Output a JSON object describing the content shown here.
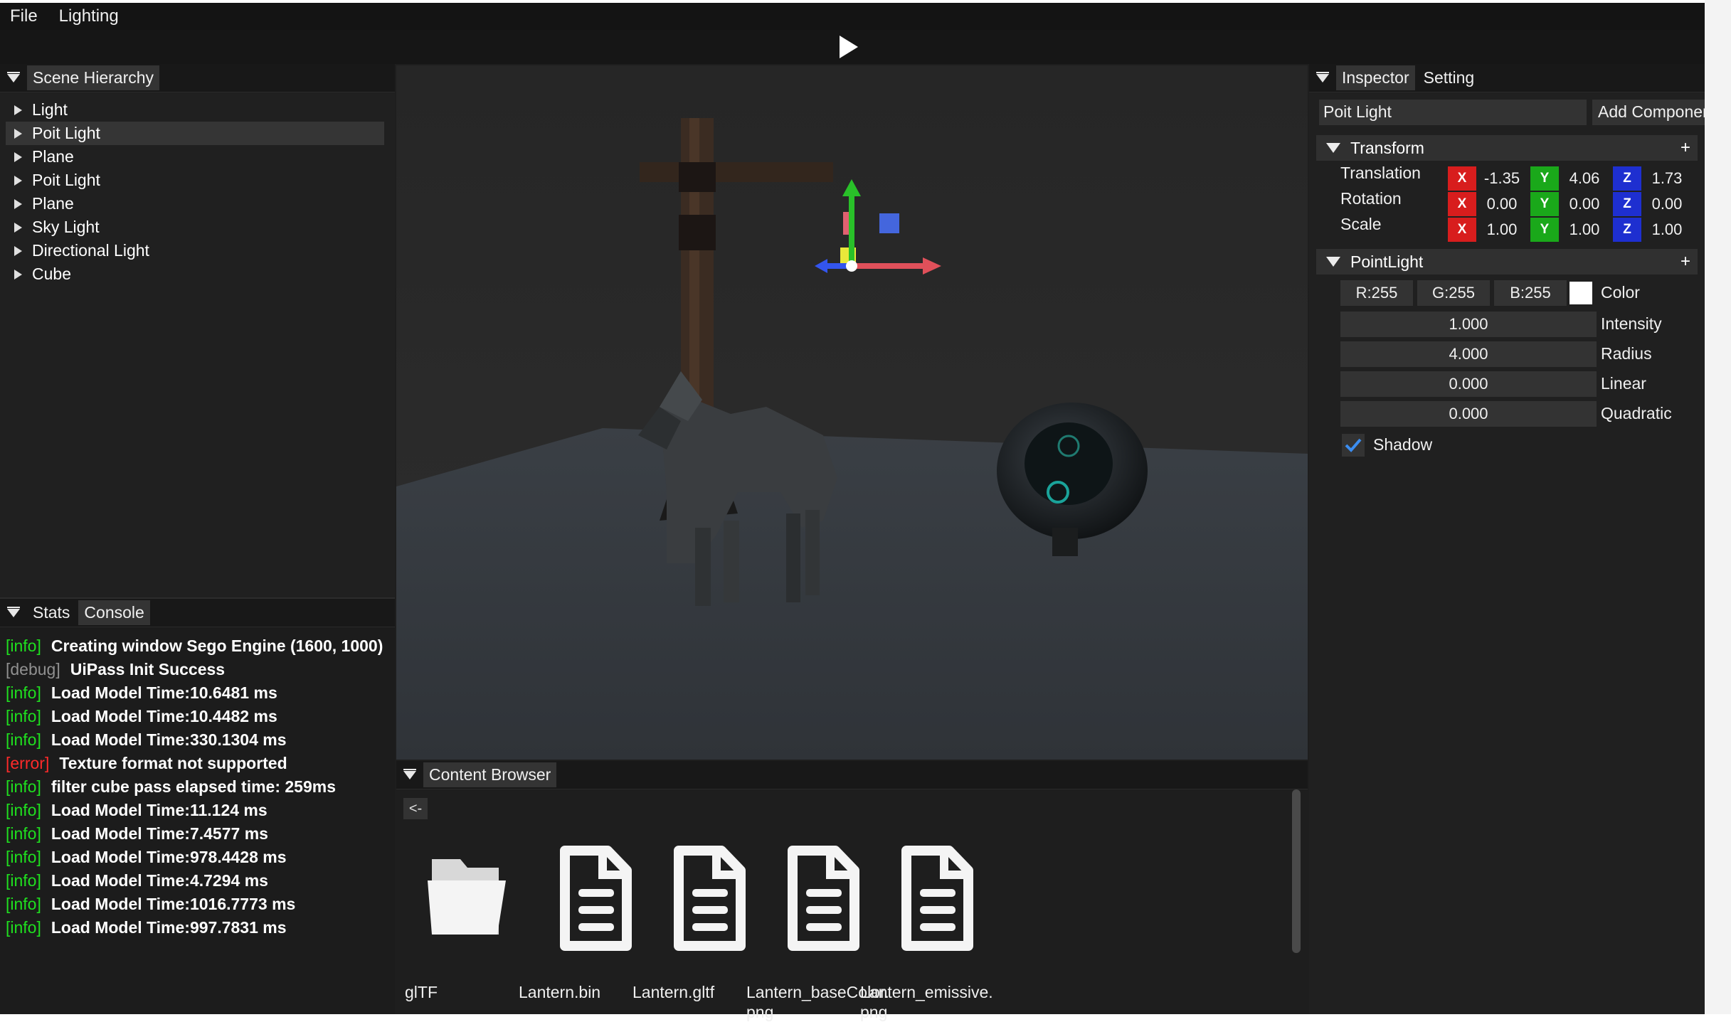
{
  "menu": {
    "file": "File",
    "lighting": "Lighting"
  },
  "hierarchy": {
    "tab": "Scene Hierarchy",
    "items": [
      {
        "label": "Light",
        "selected": false
      },
      {
        "label": "Poit Light",
        "selected": true
      },
      {
        "label": "Plane",
        "selected": false
      },
      {
        "label": "Poit Light",
        "selected": false
      },
      {
        "label": "Plane",
        "selected": false
      },
      {
        "label": "Sky Light",
        "selected": false
      },
      {
        "label": "Directional Light",
        "selected": false
      },
      {
        "label": "Cube",
        "selected": false
      }
    ]
  },
  "console": {
    "tabs": [
      "Stats",
      "Console"
    ],
    "lines": [
      {
        "tag": "[info]",
        "level": "info",
        "text": "Creating window Sego Engine (1600, 1000)"
      },
      {
        "tag": "[debug]",
        "level": "debug",
        "text": "UiPass Init Success"
      },
      {
        "tag": "[info]",
        "level": "info",
        "text": "Load Model Time:10.6481 ms"
      },
      {
        "tag": "[info]",
        "level": "info",
        "text": "Load Model Time:10.4482 ms"
      },
      {
        "tag": "[info]",
        "level": "info",
        "text": "Load Model Time:330.1304 ms"
      },
      {
        "tag": "[error]",
        "level": "error",
        "text": "Texture format not supported"
      },
      {
        "tag": "[info]",
        "level": "info",
        "text": "filter cube pass elapsed time: 259ms"
      },
      {
        "tag": "[info]",
        "level": "info",
        "text": "Load Model Time:11.124 ms"
      },
      {
        "tag": "[info]",
        "level": "info",
        "text": "Load Model Time:7.4577 ms"
      },
      {
        "tag": "[info]",
        "level": "info",
        "text": "Load Model Time:978.4428 ms"
      },
      {
        "tag": "[info]",
        "level": "info",
        "text": "Load Model Time:4.7294 ms"
      },
      {
        "tag": "[info]",
        "level": "info",
        "text": "Load Model Time:1016.7773 ms"
      },
      {
        "tag": "[info]",
        "level": "info",
        "text": "Load Model Time:997.7831 ms"
      }
    ]
  },
  "content_browser": {
    "tab": "Content Browser",
    "back": "<-",
    "files": [
      {
        "name": "glTF",
        "icon": "folder-icon"
      },
      {
        "name": "Lantern.bin",
        "icon": "file-icon"
      },
      {
        "name": "Lantern.gltf",
        "icon": "file-icon"
      },
      {
        "name": "Lantern_baseColor.\npng",
        "icon": "file-icon"
      },
      {
        "name": "Lantern_emissive.\npng",
        "icon": "file-icon"
      }
    ]
  },
  "inspector": {
    "tabs": [
      "Inspector",
      "Setting"
    ],
    "entity_name": "Poit Light",
    "add_component": "Add Component",
    "transform": {
      "title": "Transform",
      "plus": "+",
      "rows": [
        {
          "label": "Translation",
          "x": "-1.35",
          "y": "4.06",
          "z": "1.73"
        },
        {
          "label": "Rotation",
          "x": "0.00",
          "y": "0.00",
          "z": "0.00"
        },
        {
          "label": "Scale",
          "x": "1.00",
          "y": "1.00",
          "z": "1.00"
        }
      ]
    },
    "axis_labels": {
      "x": "X",
      "y": "Y",
      "z": "Z"
    },
    "point_light": {
      "title": "PointLight",
      "plus": "+",
      "r": "R:255",
      "g": "G:255",
      "b": "B:255",
      "color_label": "Color",
      "color_value": "#ffffff",
      "props": [
        {
          "value": "1.000",
          "label": "Intensity"
        },
        {
          "value": "4.000",
          "label": "Radius"
        },
        {
          "value": "0.000",
          "label": "Linear"
        },
        {
          "value": "0.000",
          "label": "Quadratic"
        }
      ],
      "shadow_label": "Shadow",
      "shadow_checked": true
    }
  },
  "colors": {
    "info": "#1fe01f",
    "debug": "#909090",
    "error": "#ff2a2a",
    "axis_x": "#d81d1d",
    "axis_y": "#1aa81a",
    "axis_z": "#1e2fd0"
  }
}
